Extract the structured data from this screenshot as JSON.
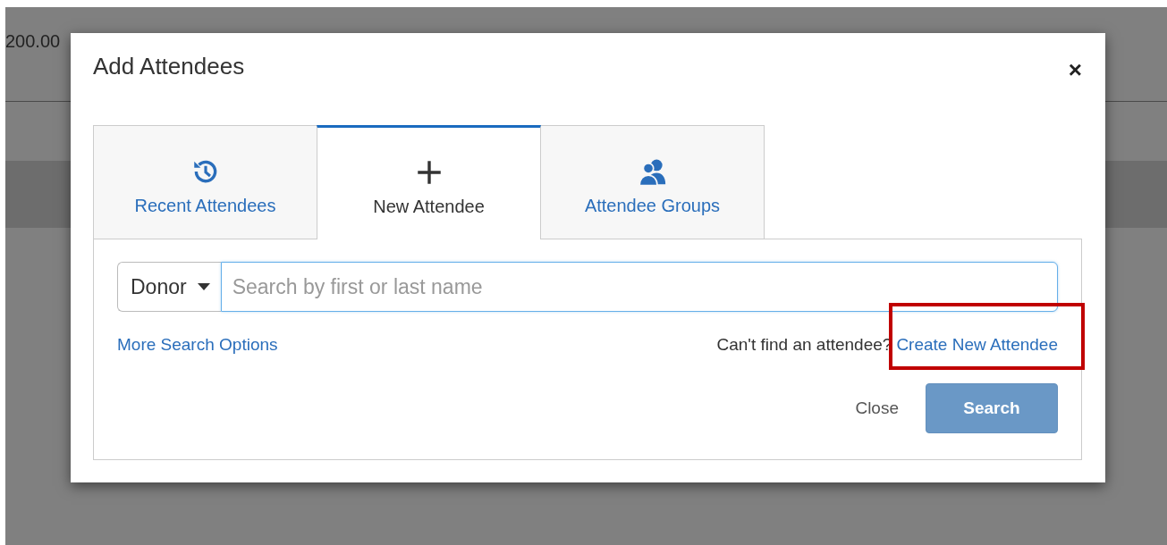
{
  "background": {
    "amount": "200.00"
  },
  "dialog": {
    "title": "Add Attendees",
    "close_icon": "×"
  },
  "tabs": [
    {
      "kind": "history",
      "label": "Recent Attendees",
      "selected": false
    },
    {
      "kind": "plus",
      "label": "New Attendee",
      "selected": true
    },
    {
      "kind": "group",
      "label": "Attendee Groups",
      "selected": false
    }
  ],
  "search": {
    "type_select": "Donor",
    "placeholder": "Search by first or last name"
  },
  "more_options_link": "More Search Options",
  "hint": "Can't find an attendee?",
  "create_link": "Create New Attendee",
  "highlight": {
    "visible": true
  },
  "buttons": [
    {
      "kind": "link",
      "label": "Close",
      "disabled": false
    },
    {
      "kind": "primary",
      "label": "Search",
      "disabled": true
    }
  ]
}
